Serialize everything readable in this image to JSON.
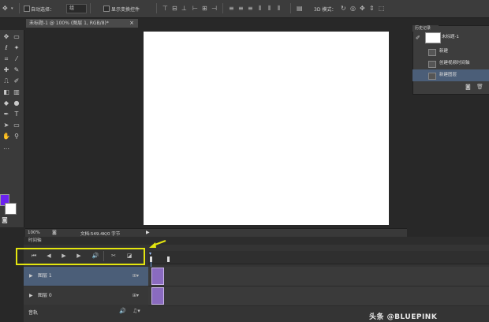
{
  "options_bar": {
    "auto_select_label": "自动选择：",
    "auto_select_value": "组",
    "show_transform_label": "显示变换控件",
    "mode_3d_label": "3D 模式："
  },
  "document": {
    "tab_title": "未标题-1 @ 100% (图层 1, RGB/8)",
    "tab_modified": "*",
    "close_glyph": "×"
  },
  "status_bar": {
    "zoom": "100%",
    "doc_info": "文档:549.4K/0 字节"
  },
  "history_panel": {
    "tab": "历史记录",
    "snapshot_name": "未标题-1",
    "items": [
      "新建",
      "创建视频时间轴",
      "新建图层"
    ]
  },
  "timeline": {
    "tab": "时间轴",
    "layers": [
      {
        "name": "图层 1"
      },
      {
        "name": "图层 0"
      }
    ],
    "audio_label": "音轨"
  },
  "watermark": "头条 @BLUEPINK",
  "colors": {
    "foreground": "#6b22f0",
    "background": "#ffffff",
    "highlight_box": "#e4e60f",
    "selected_row": "#4b5e78",
    "clip": "#8a6bbf"
  },
  "icons": {
    "first_frame": "⏮",
    "prev_frame": "◀",
    "play": "▶",
    "next_frame": "▶",
    "audio": "🔊",
    "split": "✂",
    "transition": "◪"
  }
}
